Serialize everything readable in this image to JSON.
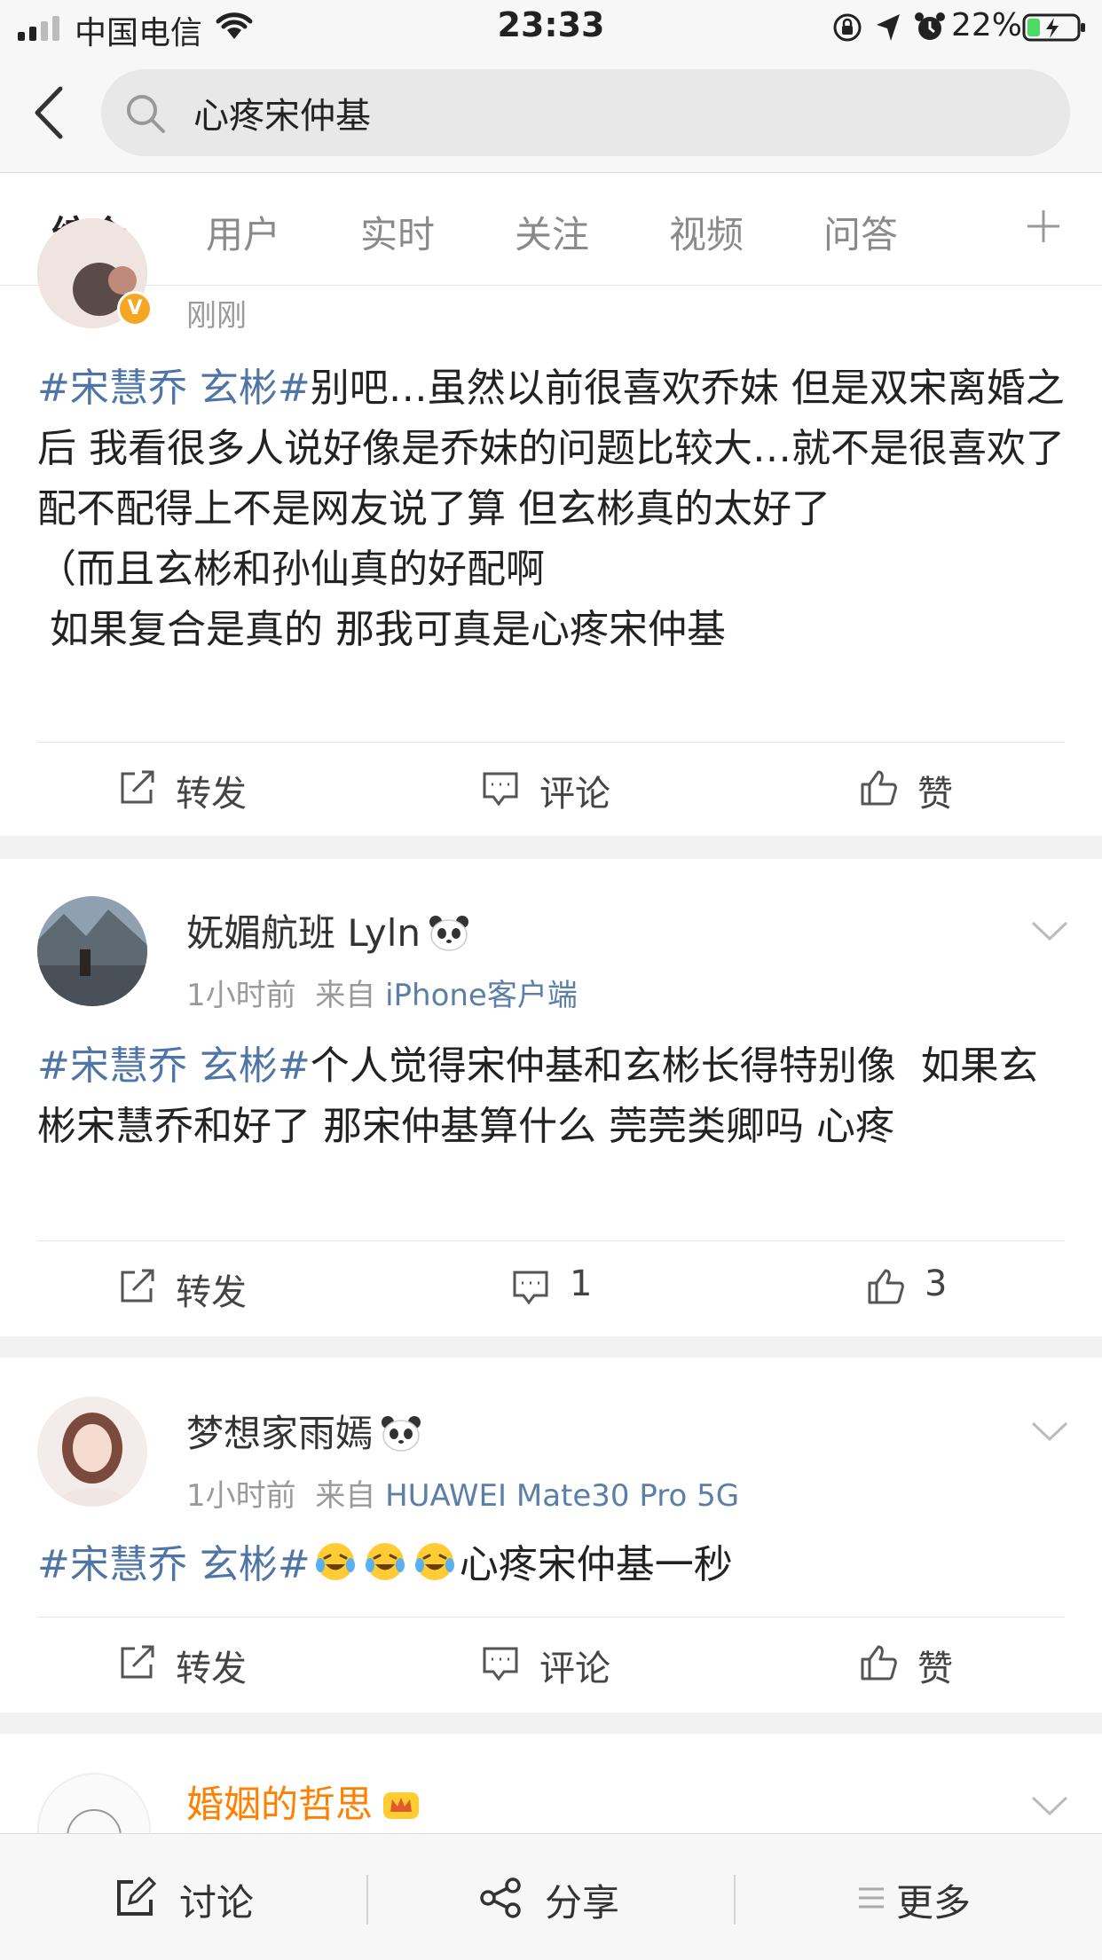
{
  "status_bar": {
    "carrier": "中国电信",
    "time": "23:33",
    "battery": "22%"
  },
  "search": {
    "query": "心疼宋仲基"
  },
  "tabs": [
    {
      "label": "综合"
    },
    {
      "label": "用户"
    },
    {
      "label": "实时"
    },
    {
      "label": "关注"
    },
    {
      "label": "视频"
    },
    {
      "label": "问答"
    }
  ],
  "posts": [
    {
      "time": "刚刚",
      "tag": "#宋慧乔 玄彬#",
      "body": "别吧…虽然以前很喜欢乔妹 但是双宋离婚之后 我看很多人说好像是乔妹的问题比较大…就不是很喜欢了\n配不配得上不是网友说了算 但玄彬真的太好了\n（而且玄彬和孙仙真的好配啊\n 如果复合是真的 那我可真是心疼宋仲基",
      "repost": "转发",
      "comment": "评论",
      "like": "赞"
    },
    {
      "username": "妩媚航班 Lyln",
      "time": "1小时前",
      "from_label": "来自",
      "source": "iPhone客户端",
      "tag": "#宋慧乔 玄彬#",
      "body": "个人觉得宋仲基和玄彬长得特别像  如果玄彬宋慧乔和好了 那宋仲基算什么 莞莞类卿吗 心疼",
      "repost": "转发",
      "comment": "1",
      "like": "3"
    },
    {
      "username": "梦想家雨嫣",
      "time": "1小时前",
      "from_label": "来自",
      "source": "HUAWEI Mate30 Pro 5G",
      "tag": "#宋慧乔 玄彬#",
      "body": "心疼宋仲基一秒",
      "repost": "转发",
      "comment": "评论",
      "like": "赞"
    },
    {
      "username": "婚姻的哲思"
    }
  ],
  "bottom_bar": {
    "discuss": "讨论",
    "share": "分享",
    "more": "更多"
  },
  "colors": {
    "accent": "#ff8200",
    "topic_link": "#4e75a6",
    "source_link": "#5b7fa6",
    "vip_name": "#ff7f00"
  }
}
